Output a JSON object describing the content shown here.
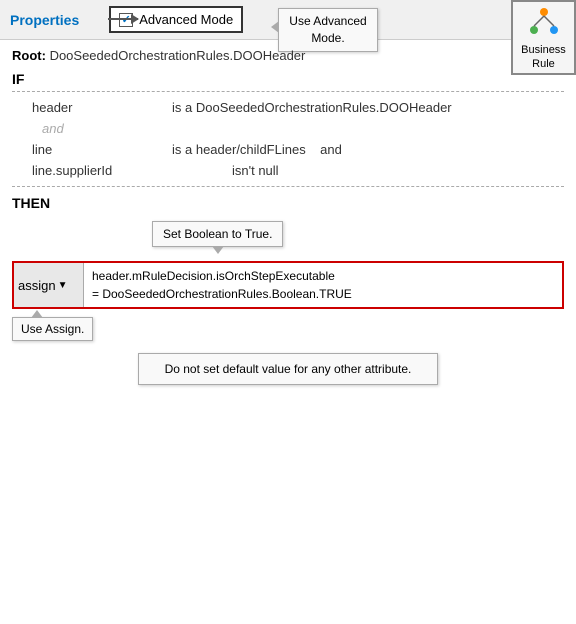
{
  "toolbar": {
    "properties_label": "Properties",
    "advanced_mode_label": "Advanced Mode",
    "use_advanced_mode_tooltip": "Use Advanced Mode.",
    "business_rule_label": "Business\nRule"
  },
  "root": {
    "label": "Root:",
    "value": "DooSeededOrchestrationRules.DOOHeader"
  },
  "if_section": {
    "label": "IF",
    "conditions": [
      {
        "subject": "header",
        "predicate": "is a DooSeededOrchestrationRules.DOOHeader"
      },
      {
        "conjunction": "and"
      },
      {
        "subject": "line",
        "predicate": "is a header/childFLines   and"
      },
      {
        "subject": "line.supplierId",
        "predicate": "isn't null"
      }
    ]
  },
  "then_section": {
    "label": "THEN",
    "set_boolean_tooltip": "Set Boolean to True.",
    "assign_label": "assign",
    "assign_value_line1": "header.mRuleDecision.isOrchStepExecutable",
    "assign_value_line2": "= DooSeededOrchestrationRules.Boolean.TRUE",
    "use_assign_tooltip": "Use Assign."
  },
  "footer": {
    "default_value_text": "Do not set default value for any other attribute."
  }
}
